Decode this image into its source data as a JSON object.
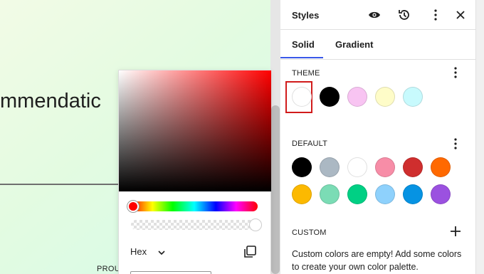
{
  "canvas": {
    "heading": "mmendatic",
    "footer": "PROU"
  },
  "picker": {
    "format_label": "Hex",
    "hue_color": "#ff0000"
  },
  "sidebar": {
    "title": "Styles",
    "tabs": [
      {
        "label": "Solid",
        "active": true
      },
      {
        "label": "Gradient",
        "active": false
      }
    ],
    "theme": {
      "label": "THEME",
      "swatches": [
        "#ffffff",
        "#000000",
        "#f8c4f2",
        "#fefcc8",
        "#c8fafd"
      ]
    },
    "default": {
      "label": "DEFAULT",
      "swatches_row1": [
        "#000000",
        "#abb8c3",
        "#ffffff",
        "#f78da7",
        "#cf2e2e",
        "#ff6900"
      ],
      "swatches_row2": [
        "#fcb900",
        "#7bdcb5",
        "#00d084",
        "#8ed1fc",
        "#0693e3",
        "#9b51e0"
      ]
    },
    "custom": {
      "label": "CUSTOM",
      "empty_message": "Custom colors are empty! Add some colors to create your own color palette."
    }
  },
  "colors": {
    "accent": "#3858e9",
    "highlight": "#d11b1b"
  }
}
